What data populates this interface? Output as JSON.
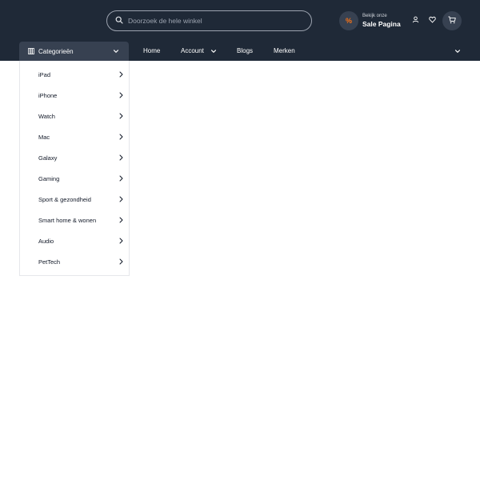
{
  "header": {
    "search": {
      "placeholder": "Doorzoek de hele winkel",
      "value": ""
    },
    "sale": {
      "badge": "%",
      "small_text": "Bekijk onze",
      "big_text": "Sale Pagina"
    },
    "icons": [
      "search-icon",
      "user-icon",
      "heart-icon",
      "cart-icon"
    ]
  },
  "nav": {
    "categories_label": "Categorieën",
    "links": [
      "Home",
      "Account",
      "Blogs",
      "Merken"
    ]
  },
  "categories": [
    {
      "label": "iPad"
    },
    {
      "label": "iPhone"
    },
    {
      "label": "Watch"
    },
    {
      "label": "Mac"
    },
    {
      "label": "Galaxy"
    },
    {
      "label": "Gaming"
    },
    {
      "label": "Sport & gezondheid"
    },
    {
      "label": "Smart home & wonen"
    },
    {
      "label": "Audio"
    },
    {
      "label": "PetTech"
    }
  ],
  "colors": {
    "header_bg": "#1f2937",
    "button_bg": "#374151",
    "sale_accent": "#f97316"
  }
}
